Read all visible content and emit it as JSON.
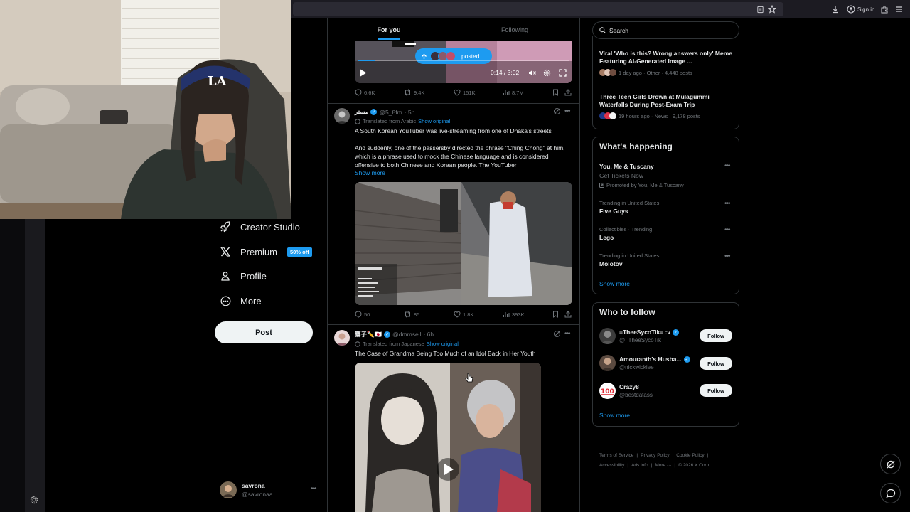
{
  "browser": {
    "signin_label": "Sign in"
  },
  "tabs": [
    {
      "label": "For you",
      "active": true
    },
    {
      "label": "Following",
      "active": false
    }
  ],
  "nav": {
    "items": [
      {
        "label": "Creator Studio",
        "icon": "rocket-icon"
      },
      {
        "label": "Premium",
        "icon": "x-logo-icon",
        "badge": "50% off"
      },
      {
        "label": "Profile",
        "icon": "person-icon"
      },
      {
        "label": "More",
        "icon": "more-circle-icon"
      }
    ],
    "post_label": "Post"
  },
  "account": {
    "name": "savrona",
    "handle": "@savronaa"
  },
  "video": {
    "posted_pill": "posted",
    "time": "0:14 / 3:02",
    "progress_fraction": 0.08
  },
  "posts": [
    {
      "stats": {
        "replies": "6.6K",
        "reposts": "9.4K",
        "likes": "151K",
        "views": "8.7M"
      }
    },
    {
      "name": "مستر",
      "handle": "@5_8fm",
      "time": "· 5h",
      "translated_from": "Translated from Arabic",
      "show_original": "Show original",
      "text1": "A South Korean YouTuber was live-streaming from one of Dhaka's streets",
      "text2": "And suddenly, one of the passersby directed the phrase \"Ching Chong\" at him, which is a phrase used to mock the Chinese language and is considered offensive to both Chinese and Korean people. The YouTuber",
      "show_more": "Show more",
      "stats": {
        "replies": "50",
        "reposts": "85",
        "likes": "1.8K",
        "views": "393K"
      }
    },
    {
      "name": "鷹子✏️🇯🇵",
      "handle": "@dmmsell",
      "time": "· 6h",
      "translated_from": "Translated from Japanese",
      "show_original": "Show original",
      "text1": "The Case of Grandma Being Too Much of an Idol Back in Her Youth"
    }
  ],
  "search": {
    "placeholder": "Search"
  },
  "top_trends": [
    {
      "title": "Viral 'Who is this? Wrong answers only' Meme Featuring AI-Generated Image ...",
      "meta": "1 day ago · Other · 4,448 posts"
    },
    {
      "title": "Three Teen Girls Drown at Mulagummi Waterfalls During Post-Exam Trip",
      "meta": "19 hours ago · News · 9,178 posts"
    }
  ],
  "happening": {
    "title": "What's happening",
    "items": [
      {
        "title": "You, Me & Tuscany",
        "sub": "Get Tickets Now",
        "meta": "Promoted by You, Me & Tuscany"
      },
      {
        "meta": "Trending in United States",
        "title": "Five Guys"
      },
      {
        "meta": "Collectibles · Trending",
        "title": "Lego"
      },
      {
        "meta": "Trending in United States",
        "title": "Molotov"
      }
    ],
    "show_more": "Show more"
  },
  "who_to_follow": {
    "title": "Who to follow",
    "items": [
      {
        "name": "=TheeSycoTik= :v",
        "handle": "@_TheeSycoTik_",
        "button": "Follow"
      },
      {
        "name": "Amouranth's Husba...",
        "handle": "@nickwickiee",
        "button": "Follow"
      },
      {
        "name": "Crazy8",
        "handle": "@bestdatass",
        "button": "Follow"
      }
    ],
    "show_more": "Show more"
  },
  "footer": {
    "links": [
      "Terms of Service",
      "Privacy Policy",
      "Cookie Policy",
      "Accessibility",
      "Ads info",
      "More ···"
    ],
    "copyright": "© 2026 X Corp."
  },
  "colors": {
    "accent": "#1d9bf0",
    "background": "#000000",
    "border": "#2f3336",
    "muted": "#71767b"
  }
}
